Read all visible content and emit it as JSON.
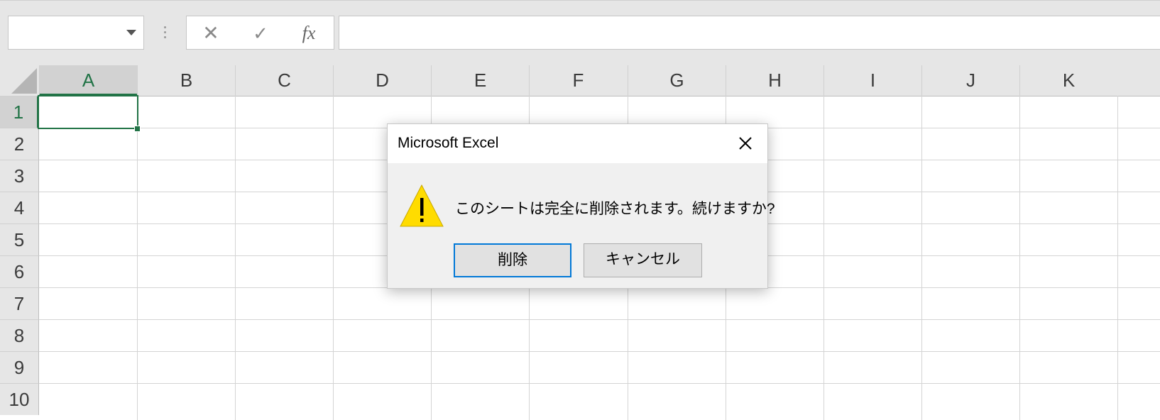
{
  "formula_bar": {
    "name_box_value": "",
    "cancel_glyph": "✕",
    "enter_glyph": "✓",
    "function_label": "fx",
    "formula_value": ""
  },
  "grid": {
    "columns": [
      "A",
      "B",
      "C",
      "D",
      "E",
      "F",
      "G",
      "H",
      "I",
      "J",
      "K"
    ],
    "rows": [
      "1",
      "2",
      "3",
      "4",
      "5",
      "6",
      "7",
      "8",
      "9",
      "10"
    ],
    "selected_column": "A",
    "selected_row": "1",
    "accent_color": "#217346"
  },
  "dialog": {
    "title": "Microsoft Excel",
    "message": "このシートは完全に削除されます。続けますか?",
    "icon": "warning-icon",
    "delete_label": "削除",
    "cancel_label": "キャンセル",
    "focus_color": "#0078d7"
  }
}
